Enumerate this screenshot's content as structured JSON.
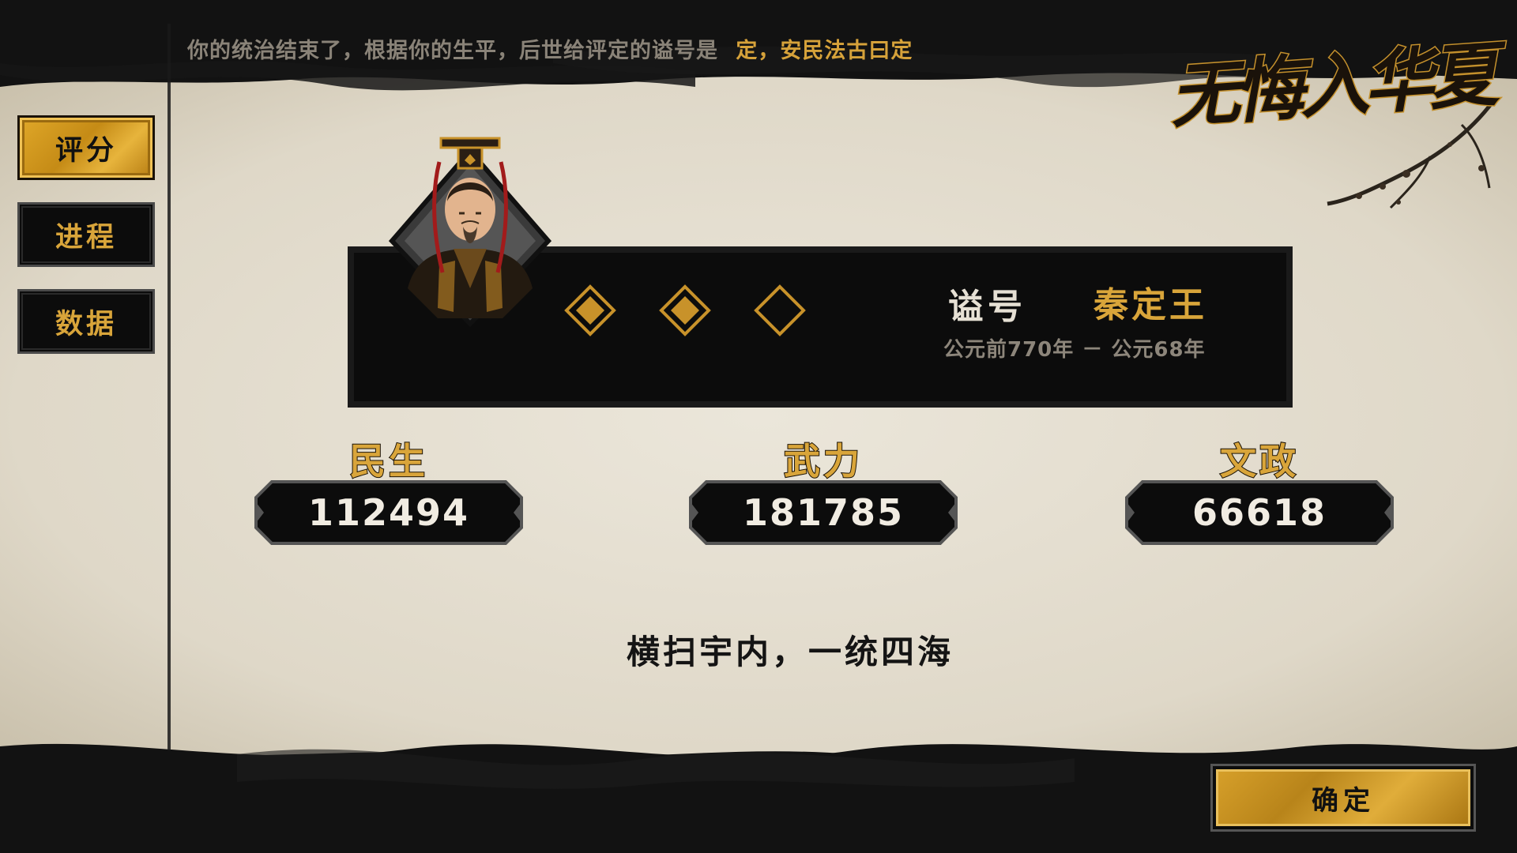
{
  "header": {
    "message": "你的统治结束了，根据你的生平，后世给评定的谥号是",
    "title_meaning": "定，安民法古曰定"
  },
  "logo": {
    "text": "无悔入华夏"
  },
  "sidebar": {
    "tabs": [
      {
        "label": "评分",
        "active": true
      },
      {
        "label": "进程",
        "active": false
      },
      {
        "label": "数据",
        "active": false
      }
    ]
  },
  "ruler": {
    "posthumous_label": "谥号",
    "posthumous_title": "秦定王",
    "reign_period": "公元前770年 － 公元68年",
    "stars": {
      "filled": 2,
      "total": 3
    }
  },
  "stats": [
    {
      "label": "民生",
      "value": "112494"
    },
    {
      "label": "武力",
      "value": "181785"
    },
    {
      "label": "文政",
      "value": "66618"
    }
  ],
  "motto": "横扫宇内，一统四海",
  "confirm_label": "确定",
  "colors": {
    "gold": "#d9a53a",
    "parchment": "#e4ded1",
    "ink": "#111111"
  }
}
